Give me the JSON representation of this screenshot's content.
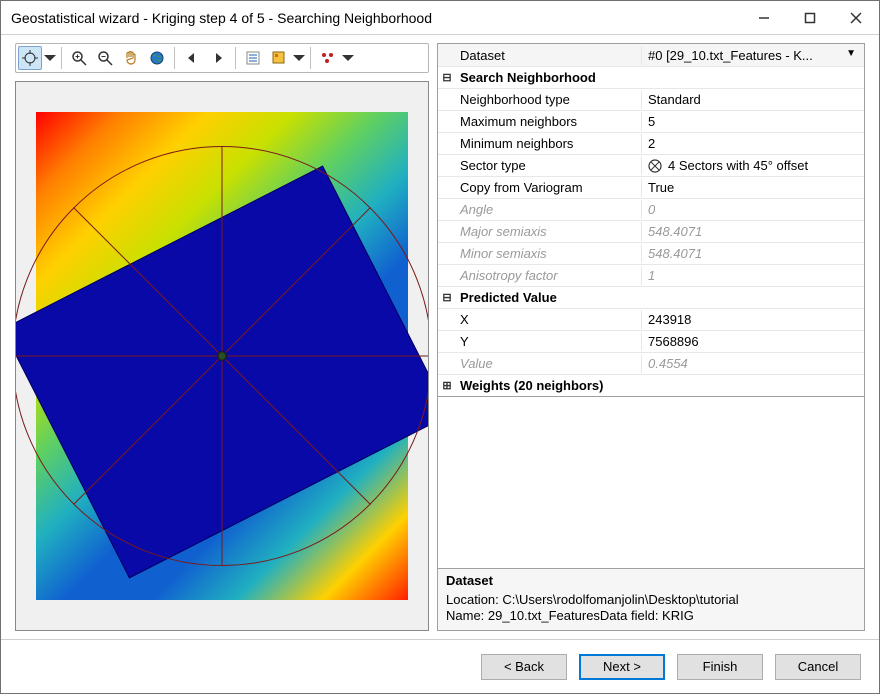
{
  "window": {
    "title": "Geostatistical wizard - Kriging step 4 of 5 - Searching Neighborhood"
  },
  "toolbar": {
    "tools": [
      "pan-crosshair",
      "zoom-in",
      "zoom-out",
      "pan-hand",
      "full-extent",
      "prev-extent",
      "next-extent",
      "list",
      "layer-picker",
      "points"
    ]
  },
  "props": {
    "dataset_label": "Dataset",
    "dataset_value": "#0 [29_10.txt_Features - K...",
    "search_neighborhood_header": "Search Neighborhood",
    "neighborhood_type_label": "Neighborhood type",
    "neighborhood_type_value": "Standard",
    "max_neighbors_label": "Maximum neighbors",
    "max_neighbors_value": "5",
    "min_neighbors_label": "Minimum neighbors",
    "min_neighbors_value": "2",
    "sector_type_label": "Sector type",
    "sector_type_value": "4 Sectors with 45° offset",
    "copy_from_variogram_label": "Copy from Variogram",
    "copy_from_variogram_value": "True",
    "angle_label": "Angle",
    "angle_value": "0",
    "major_semiaxis_label": "Major semiaxis",
    "major_semiaxis_value": "548.4071",
    "minor_semiaxis_label": "Minor semiaxis",
    "minor_semiaxis_value": "548.4071",
    "anisotropy_label": "Anisotropy factor",
    "anisotropy_value": "1",
    "predicted_value_header": "Predicted Value",
    "x_label": "X",
    "x_value": "243918",
    "y_label": "Y",
    "y_value": "7568896",
    "value_label": "Value",
    "value_value": "0.4554",
    "weights_header": "Weights (20 neighbors)"
  },
  "help": {
    "heading": "Dataset",
    "line1": "Location: C:\\Users\\rodolfomanjolin\\Desktop\\tutorial",
    "line2": "Name: 29_10.txt_FeaturesData field: KRIG"
  },
  "buttons": {
    "back": "< Back",
    "next": "Next >",
    "finish": "Finish",
    "cancel": "Cancel"
  }
}
